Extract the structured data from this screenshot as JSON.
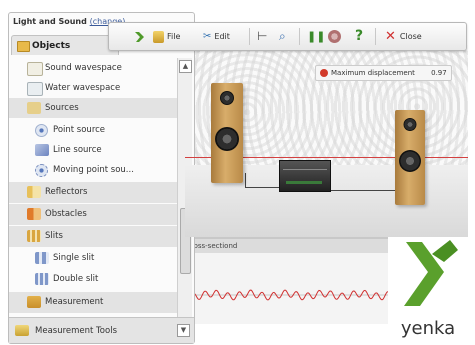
{
  "window": {
    "title": "Light and Sound",
    "title_link": "(change)"
  },
  "tabs": {
    "objects_label": "Objects"
  },
  "toolbar": {
    "file_label": "File",
    "edit_label": "Edit",
    "close_label": "Close"
  },
  "sidebar": {
    "items": [
      {
        "label": "Sound wavespace",
        "icon": "wavespace-icon"
      },
      {
        "label": "Water wavespace",
        "icon": "wavespace-icon"
      },
      {
        "label": "Sources",
        "icon": "sources-icon"
      },
      {
        "label": "Point source",
        "icon": "point-source-icon"
      },
      {
        "label": "Line source",
        "icon": "line-source-icon"
      },
      {
        "label": "Moving point sou...",
        "icon": "moving-point-source-icon"
      },
      {
        "label": "Reflectors",
        "icon": "reflectors-icon"
      },
      {
        "label": "Obstacles",
        "icon": "obstacles-icon"
      },
      {
        "label": "Slits",
        "icon": "slits-icon"
      },
      {
        "label": "Single slit",
        "icon": "single-slit-icon"
      },
      {
        "label": "Double slit",
        "icon": "double-slit-icon"
      },
      {
        "label": "Measurement",
        "icon": "measurement-icon"
      }
    ],
    "footer_label": "Measurement Tools"
  },
  "scene": {
    "max_displacement_label": "Maximum displacement",
    "max_displacement_value": "0.97"
  },
  "graph": {
    "header": "cross-sectiond"
  },
  "logo": {
    "text": "yenka"
  },
  "colors": {
    "accent_red": "#d34040",
    "logo_green": "#5aa02c",
    "speaker_wood": "#c99a55"
  }
}
